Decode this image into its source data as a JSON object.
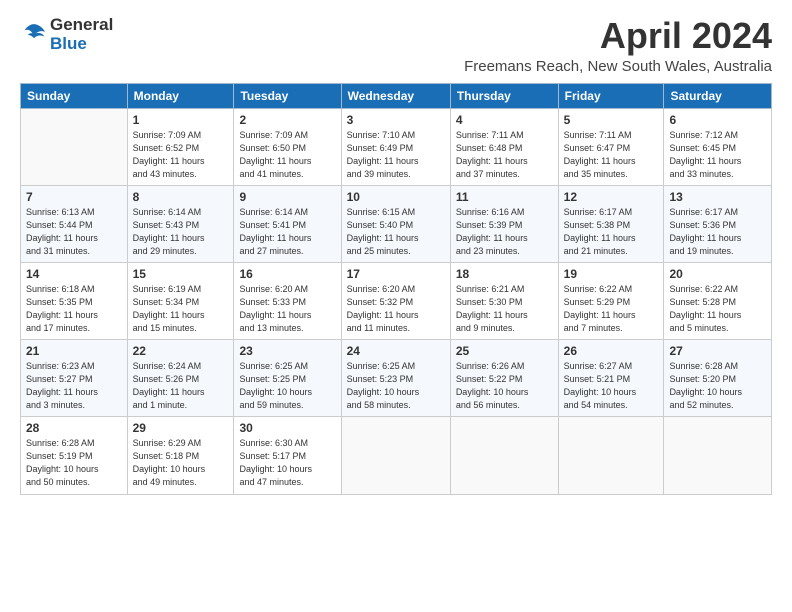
{
  "header": {
    "logo_general": "General",
    "logo_blue": "Blue",
    "month_title": "April 2024",
    "location": "Freemans Reach, New South Wales, Australia"
  },
  "weekdays": [
    "Sunday",
    "Monday",
    "Tuesday",
    "Wednesday",
    "Thursday",
    "Friday",
    "Saturday"
  ],
  "weeks": [
    [
      {
        "day": "",
        "info": ""
      },
      {
        "day": "1",
        "info": "Sunrise: 7:09 AM\nSunset: 6:52 PM\nDaylight: 11 hours\nand 43 minutes."
      },
      {
        "day": "2",
        "info": "Sunrise: 7:09 AM\nSunset: 6:50 PM\nDaylight: 11 hours\nand 41 minutes."
      },
      {
        "day": "3",
        "info": "Sunrise: 7:10 AM\nSunset: 6:49 PM\nDaylight: 11 hours\nand 39 minutes."
      },
      {
        "day": "4",
        "info": "Sunrise: 7:11 AM\nSunset: 6:48 PM\nDaylight: 11 hours\nand 37 minutes."
      },
      {
        "day": "5",
        "info": "Sunrise: 7:11 AM\nSunset: 6:47 PM\nDaylight: 11 hours\nand 35 minutes."
      },
      {
        "day": "6",
        "info": "Sunrise: 7:12 AM\nSunset: 6:45 PM\nDaylight: 11 hours\nand 33 minutes."
      }
    ],
    [
      {
        "day": "7",
        "info": "Sunrise: 6:13 AM\nSunset: 5:44 PM\nDaylight: 11 hours\nand 31 minutes."
      },
      {
        "day": "8",
        "info": "Sunrise: 6:14 AM\nSunset: 5:43 PM\nDaylight: 11 hours\nand 29 minutes."
      },
      {
        "day": "9",
        "info": "Sunrise: 6:14 AM\nSunset: 5:41 PM\nDaylight: 11 hours\nand 27 minutes."
      },
      {
        "day": "10",
        "info": "Sunrise: 6:15 AM\nSunset: 5:40 PM\nDaylight: 11 hours\nand 25 minutes."
      },
      {
        "day": "11",
        "info": "Sunrise: 6:16 AM\nSunset: 5:39 PM\nDaylight: 11 hours\nand 23 minutes."
      },
      {
        "day": "12",
        "info": "Sunrise: 6:17 AM\nSunset: 5:38 PM\nDaylight: 11 hours\nand 21 minutes."
      },
      {
        "day": "13",
        "info": "Sunrise: 6:17 AM\nSunset: 5:36 PM\nDaylight: 11 hours\nand 19 minutes."
      }
    ],
    [
      {
        "day": "14",
        "info": "Sunrise: 6:18 AM\nSunset: 5:35 PM\nDaylight: 11 hours\nand 17 minutes."
      },
      {
        "day": "15",
        "info": "Sunrise: 6:19 AM\nSunset: 5:34 PM\nDaylight: 11 hours\nand 15 minutes."
      },
      {
        "day": "16",
        "info": "Sunrise: 6:20 AM\nSunset: 5:33 PM\nDaylight: 11 hours\nand 13 minutes."
      },
      {
        "day": "17",
        "info": "Sunrise: 6:20 AM\nSunset: 5:32 PM\nDaylight: 11 hours\nand 11 minutes."
      },
      {
        "day": "18",
        "info": "Sunrise: 6:21 AM\nSunset: 5:30 PM\nDaylight: 11 hours\nand 9 minutes."
      },
      {
        "day": "19",
        "info": "Sunrise: 6:22 AM\nSunset: 5:29 PM\nDaylight: 11 hours\nand 7 minutes."
      },
      {
        "day": "20",
        "info": "Sunrise: 6:22 AM\nSunset: 5:28 PM\nDaylight: 11 hours\nand 5 minutes."
      }
    ],
    [
      {
        "day": "21",
        "info": "Sunrise: 6:23 AM\nSunset: 5:27 PM\nDaylight: 11 hours\nand 3 minutes."
      },
      {
        "day": "22",
        "info": "Sunrise: 6:24 AM\nSunset: 5:26 PM\nDaylight: 11 hours\nand 1 minute."
      },
      {
        "day": "23",
        "info": "Sunrise: 6:25 AM\nSunset: 5:25 PM\nDaylight: 10 hours\nand 59 minutes."
      },
      {
        "day": "24",
        "info": "Sunrise: 6:25 AM\nSunset: 5:23 PM\nDaylight: 10 hours\nand 58 minutes."
      },
      {
        "day": "25",
        "info": "Sunrise: 6:26 AM\nSunset: 5:22 PM\nDaylight: 10 hours\nand 56 minutes."
      },
      {
        "day": "26",
        "info": "Sunrise: 6:27 AM\nSunset: 5:21 PM\nDaylight: 10 hours\nand 54 minutes."
      },
      {
        "day": "27",
        "info": "Sunrise: 6:28 AM\nSunset: 5:20 PM\nDaylight: 10 hours\nand 52 minutes."
      }
    ],
    [
      {
        "day": "28",
        "info": "Sunrise: 6:28 AM\nSunset: 5:19 PM\nDaylight: 10 hours\nand 50 minutes."
      },
      {
        "day": "29",
        "info": "Sunrise: 6:29 AM\nSunset: 5:18 PM\nDaylight: 10 hours\nand 49 minutes."
      },
      {
        "day": "30",
        "info": "Sunrise: 6:30 AM\nSunset: 5:17 PM\nDaylight: 10 hours\nand 47 minutes."
      },
      {
        "day": "",
        "info": ""
      },
      {
        "day": "",
        "info": ""
      },
      {
        "day": "",
        "info": ""
      },
      {
        "day": "",
        "info": ""
      }
    ]
  ]
}
